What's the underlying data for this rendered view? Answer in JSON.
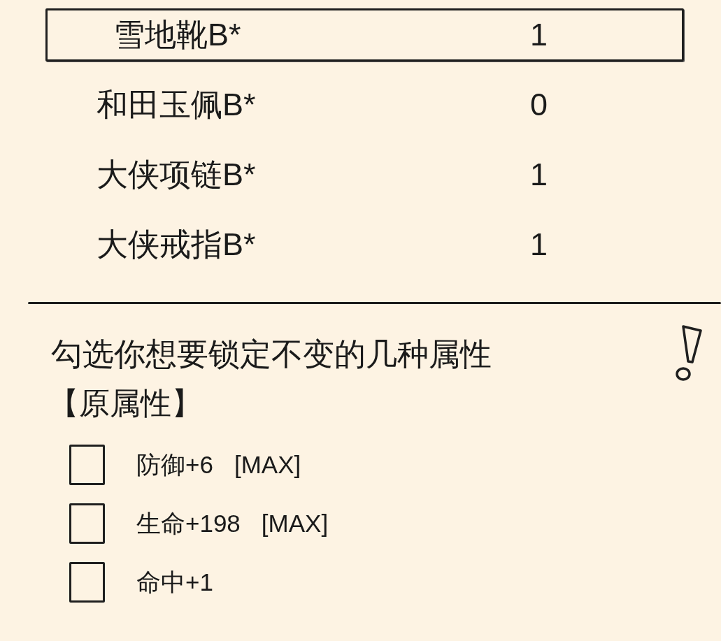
{
  "items": [
    {
      "name": "雪地靴B*",
      "count": "1",
      "selected": true
    },
    {
      "name": "和田玉佩B*",
      "count": "0",
      "selected": false
    },
    {
      "name": "大侠项链B*",
      "count": "1",
      "selected": false
    },
    {
      "name": "大侠戒指B*",
      "count": "1",
      "selected": false
    }
  ],
  "prompt": "勾选你想要锁定不变的几种属性",
  "section_title": "【原属性】",
  "attributes": [
    {
      "label": "防御+6",
      "tag": "[MAX]",
      "checked": false
    },
    {
      "label": "生命+198",
      "tag": "[MAX]",
      "checked": false
    },
    {
      "label": "命中+1",
      "checked": false
    }
  ]
}
